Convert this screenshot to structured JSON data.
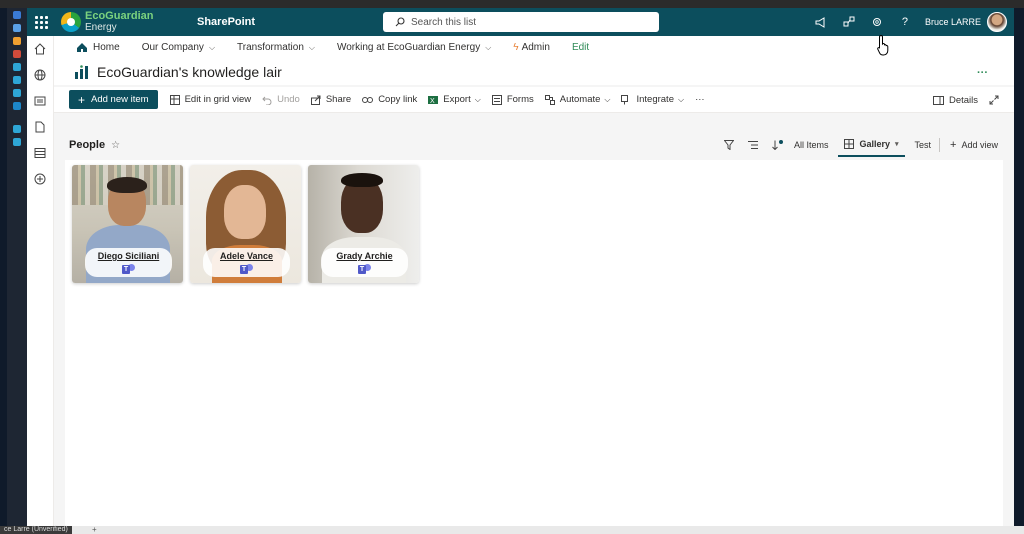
{
  "header": {
    "brand_line1": "EcoGuardian",
    "brand_line2": "Energy",
    "app_name": "SharePoint",
    "search_placeholder": "Search this list",
    "user_name": "Bruce LARRE"
  },
  "topnav": {
    "home": "Home",
    "items": [
      "Our Company",
      "Transformation",
      "Working at EcoGuardian Energy"
    ],
    "admin": "Admin",
    "edit": "Edit"
  },
  "site": {
    "title": "EcoGuardian's knowledge lair",
    "more": "···"
  },
  "commandbar": {
    "new_item": "Add new item",
    "edit_grid": "Edit in grid view",
    "undo": "Undo",
    "share": "Share",
    "copy_link": "Copy link",
    "export": "Export",
    "forms": "Forms",
    "automate": "Automate",
    "integrate": "Integrate",
    "overflow": "···",
    "details": "Details"
  },
  "list": {
    "title": "People",
    "views": {
      "all_items": "All Items",
      "gallery": "Gallery",
      "test": "Test",
      "add_view": "Add view"
    }
  },
  "people": [
    {
      "name": "Diego Siciliani"
    },
    {
      "name": "Adele Vance"
    },
    {
      "name": "Grady Archie"
    }
  ],
  "taskbar": {
    "tab_label": "ce Larre (Unverified)",
    "plus": "+"
  },
  "colors": {
    "header_bg": "#0c4e5d",
    "accent_green": "#2e8b57",
    "teams_purple": "#5059c9"
  }
}
